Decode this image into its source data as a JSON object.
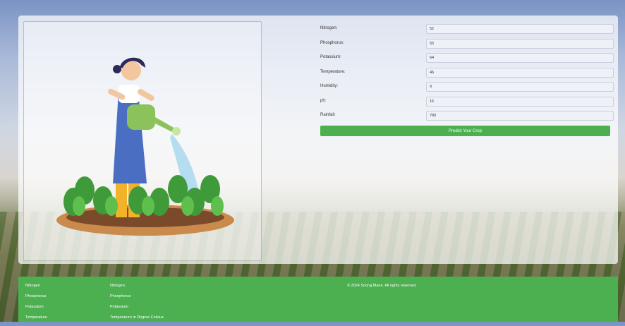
{
  "form": {
    "fields": [
      {
        "label": "Nitrogen:",
        "value": "52"
      },
      {
        "label": "Phosphorus:",
        "value": "55"
      },
      {
        "label": "Potassium:",
        "value": "64"
      },
      {
        "label": "Temperature:",
        "value": "46"
      },
      {
        "label": "Humidity:",
        "value": "9"
      },
      {
        "label": "ph:",
        "value": "15"
      },
      {
        "label": "Rainfall:",
        "value": "780"
      }
    ],
    "submit_label": "Predict Your Crop"
  },
  "footer": {
    "col1": [
      "Nitrogen",
      "Phosphorus",
      "Potassium",
      "Temperature"
    ],
    "col2": [
      "Nitrogen",
      "Phosphorus",
      "Potassium",
      "Temperature in Degree Celsius"
    ],
    "copyright": "© 2024 Sooraj Mane. All rights reserved."
  },
  "colors": {
    "accent": "#4caf50"
  },
  "icons": {
    "illustration": "farmer-watering-plants-illustration"
  }
}
